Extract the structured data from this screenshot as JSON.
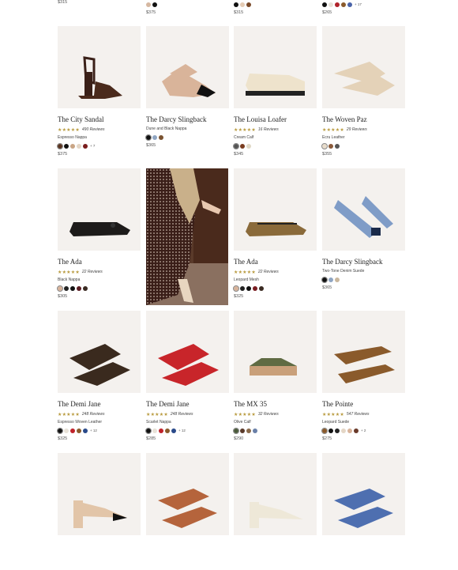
{
  "top_row": [
    {
      "price": "$315",
      "swatches": []
    },
    {
      "price": "$375",
      "swatches": [
        "#d6b8a1",
        "#111111"
      ]
    },
    {
      "price": "$315",
      "swatches": [
        "#111111",
        "#e5ccb5",
        "#7a4a2a"
      ]
    },
    {
      "price": "$265",
      "swatches": [
        "#111111",
        "#e8e2d8",
        "#b0222a",
        "#8a5a2b",
        "#4a63a8"
      ],
      "more": "+ 17"
    }
  ],
  "products": [
    {
      "name": "The City Sandal",
      "stars": "★★★★★",
      "reviews": "490 Reviews",
      "variant": "Espresso Nappa",
      "swatches": [
        "#5a3420",
        "#111111",
        "#c9a585",
        "#e4d6c6",
        "#7a1d1d"
      ],
      "more": "+ 7",
      "price": "$375"
    },
    {
      "name": "The Darcy Slingback",
      "stars": "",
      "reviews": "",
      "variant": "Dune and Black Nappa",
      "swatches": [
        "#111111",
        "#8fa5c2",
        "#7a5230"
      ],
      "more": "",
      "price": "$365"
    },
    {
      "name": "The Louisa Loafer",
      "stars": "★★★★★",
      "reviews": "16 Reviews",
      "variant": "Cream Calf",
      "swatches": [
        "#555555",
        "#7a3c20",
        "#e0d8c6"
      ],
      "more": "",
      "price": "$345"
    },
    {
      "name": "The Woven Paz",
      "stars": "★★★★★",
      "reviews": "29 Reviews",
      "variant": "Ecru Leather",
      "swatches": [
        "#e8dccb",
        "#8a5a3a",
        "#555555"
      ],
      "more": "",
      "price": "$355"
    },
    {
      "name": "The Ada",
      "stars": "★★★★★",
      "reviews": "22 Reviews",
      "variant": "Black Nappa",
      "swatches": [
        "#d8b39a",
        "#222222",
        "#111111",
        "#5a1c22",
        "#3a2a22"
      ],
      "more": "",
      "price": "$305"
    },
    {
      "name": "The Ada",
      "stars": "★★★★★",
      "reviews": "22 Reviews",
      "variant": "Leopard Mesh",
      "swatches": [
        "#d8b39a",
        "#222222",
        "#111111",
        "#7a1d22",
        "#3a2a22"
      ],
      "more": "",
      "price": "$325"
    },
    {
      "name": "The Darcy Slingback",
      "stars": "",
      "reviews": "",
      "variant": "Two-Tone Denim Suede",
      "swatches": [
        "#111111",
        "#8fa5c2",
        "#c9b79e"
      ],
      "more": "",
      "price": "$365"
    },
    {
      "name": "The Demi Jane",
      "stars": "★★★★★",
      "reviews": "248 Reviews",
      "variant": "Espresso Woven Leather",
      "swatches": [
        "#111111",
        "#e8e2d8",
        "#c0222a",
        "#8a5a2b",
        "#2a4a8a"
      ],
      "more": "+ 12",
      "price": "$325"
    },
    {
      "name": "The Demi Jane",
      "stars": "★★★★★",
      "reviews": "248 Reviews",
      "variant": "Scarlet Nappa",
      "swatches": [
        "#111111",
        "#e8e2d8",
        "#c0222a",
        "#8a5a2b",
        "#2a4a8a"
      ],
      "more": "+ 12",
      "price": "$285"
    },
    {
      "name": "The MX 35",
      "stars": "★★★★★",
      "reviews": "32 Reviews",
      "variant": "Olive Calf",
      "swatches": [
        "#4a5a3a",
        "#5a3a2a",
        "#8a6a4a",
        "#6a80a8"
      ],
      "more": "",
      "price": "$290"
    },
    {
      "name": "The Pointe",
      "stars": "★★★★★",
      "reviews": "547 Reviews",
      "variant": "Leopard Suede",
      "swatches": [
        "#8a5a2b",
        "#111111",
        "#222222",
        "#e4d6c6",
        "#d8b39a",
        "#6a3a2a"
      ],
      "more": "+ 2",
      "price": "$275"
    },
    {
      "name": "",
      "stars": "",
      "reviews": "",
      "variant": "",
      "swatches": [],
      "more": "",
      "price": ""
    },
    {
      "name": "",
      "stars": "",
      "reviews": "",
      "variant": "",
      "swatches": [],
      "more": "",
      "price": ""
    },
    {
      "name": "",
      "stars": "",
      "reviews": "",
      "variant": "",
      "swatches": [],
      "more": "",
      "price": ""
    },
    {
      "name": "",
      "stars": "",
      "reviews": "",
      "variant": "",
      "swatches": [],
      "more": "",
      "price": ""
    }
  ]
}
